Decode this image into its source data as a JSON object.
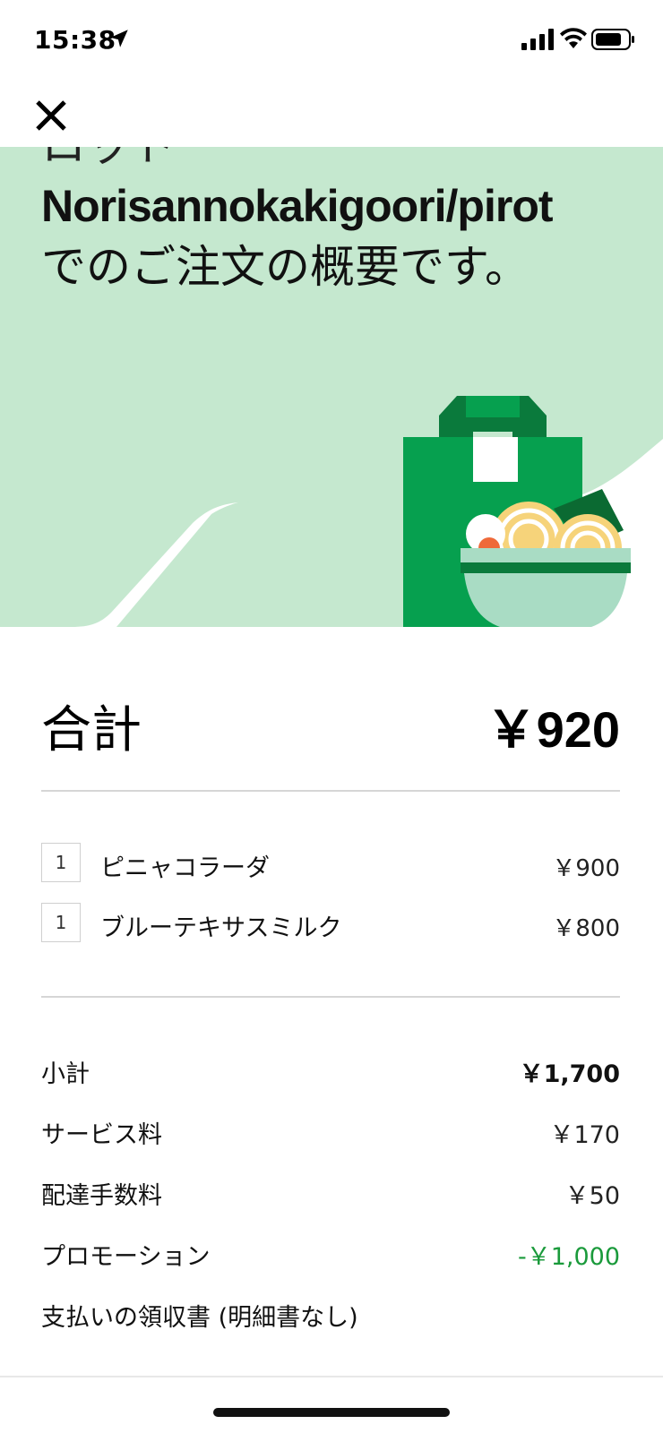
{
  "status_bar": {
    "time": "15:38"
  },
  "hero": {
    "line1": "ロット",
    "restaurant": "Norisannokakigoori/pirot",
    "line3": "でのご注文の概要です。"
  },
  "total": {
    "label": "合計",
    "value": "￥920"
  },
  "items": [
    {
      "qty": "1",
      "name": "ピニャコラーダ",
      "price": "￥900"
    },
    {
      "qty": "1",
      "name": "ブルーテキサスミルク",
      "price": "￥800"
    }
  ],
  "fees": {
    "subtotal": {
      "label": "小計",
      "value": "￥1,700"
    },
    "service": {
      "label": "サービス料",
      "value": "￥170"
    },
    "delivery": {
      "label": "配達手数料",
      "value": "￥50"
    },
    "promotion": {
      "label": "プロモーション",
      "value": "-￥1,000"
    },
    "receipt": {
      "label": "支払いの領収書 (明細書なし)"
    }
  },
  "colors": {
    "hero_bg": "#c5e8cf",
    "bag_green": "#06a04f",
    "promo_green": "#1a9a3b"
  }
}
